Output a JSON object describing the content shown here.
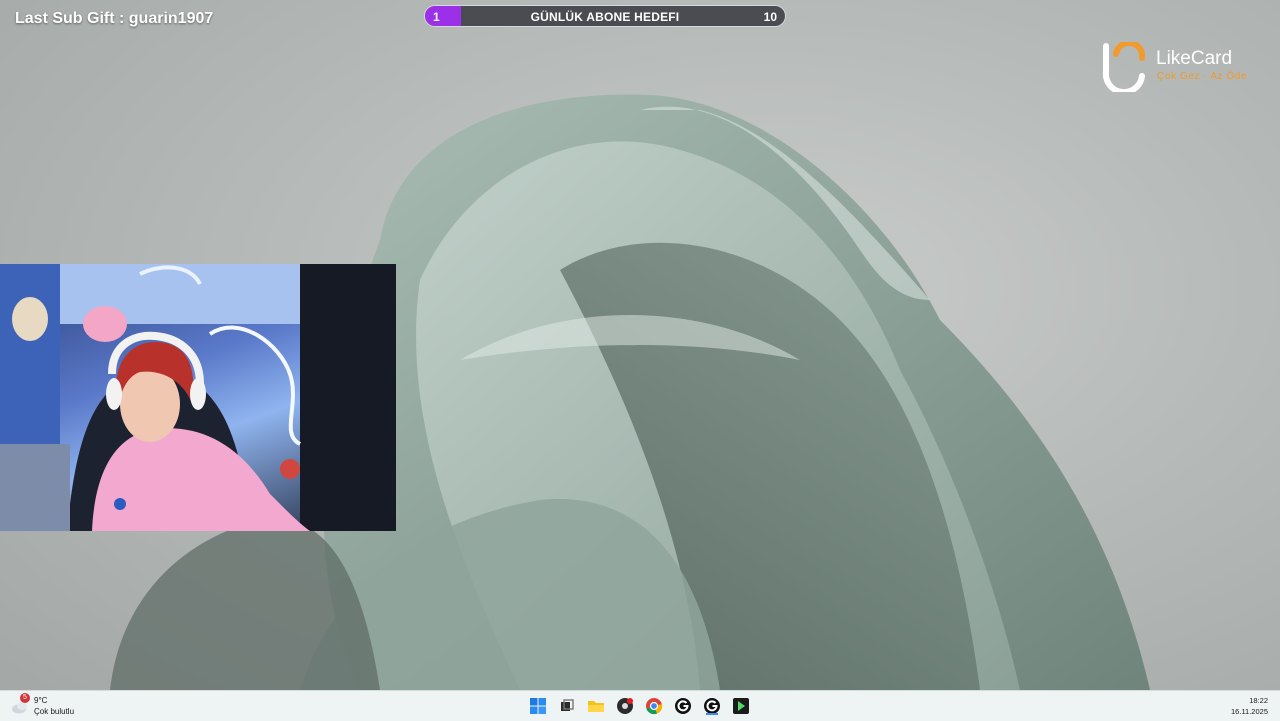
{
  "overlay": {
    "last_sub_label": "Last Sub Gift : ",
    "last_sub_user": "guarin1907"
  },
  "goal": {
    "title": "GÜNLÜK ABONE HEDEFI",
    "current": "1",
    "target": "10",
    "progress_fraction": 0.1,
    "fill_color": "#9b30e8"
  },
  "logo": {
    "name": "LikeCard",
    "slogan": "Çok Gez · Az Öde",
    "accent_color": "#f19a2e"
  },
  "taskbar": {
    "weather": {
      "temperature": "9°C",
      "condition": "Çok bulutlu",
      "badge": "5"
    },
    "apps": [
      {
        "name": "start-icon"
      },
      {
        "name": "task-view-icon"
      },
      {
        "name": "file-explorer-icon"
      },
      {
        "name": "obs-icon"
      },
      {
        "name": "chrome-icon"
      },
      {
        "name": "logitech-g-icon"
      },
      {
        "name": "logitech-g-hub-icon"
      },
      {
        "name": "stream-app-icon"
      }
    ],
    "clock": {
      "time": "18:22",
      "date": "16.11.2025"
    }
  }
}
